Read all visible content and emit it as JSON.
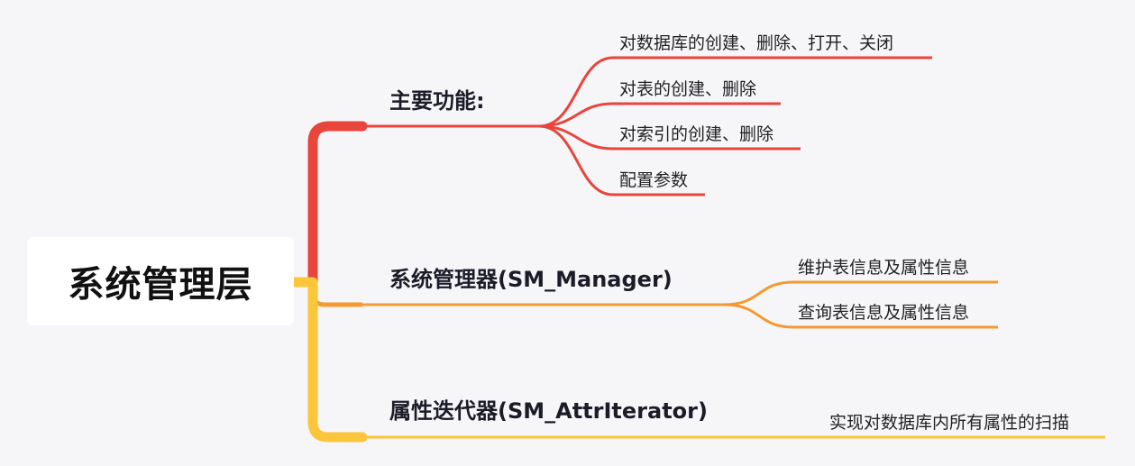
{
  "root": {
    "label": "系统管理层"
  },
  "colors": {
    "red": "#e8453c",
    "orange": "#f59a33",
    "yellow": "#fcc63a",
    "root_bg": "#ffffff",
    "background": "#f6f6f9"
  },
  "branches": [
    {
      "label": "主要功能:",
      "color": "#e8453c",
      "children": [
        "对数据库的创建、删除、打开、关闭",
        "对表的创建、删除",
        "对索引的创建、删除",
        "配置参数"
      ]
    },
    {
      "label": "系统管理器(SM_Manager)",
      "color": "#f59a33",
      "children": [
        "维护表信息及属性信息",
        "查询表信息及属性信息"
      ]
    },
    {
      "label": "属性迭代器(SM_AttrIterator)",
      "color": "#fcc63a",
      "children": [
        "实现对数据库内所有属性的扫描"
      ]
    }
  ]
}
